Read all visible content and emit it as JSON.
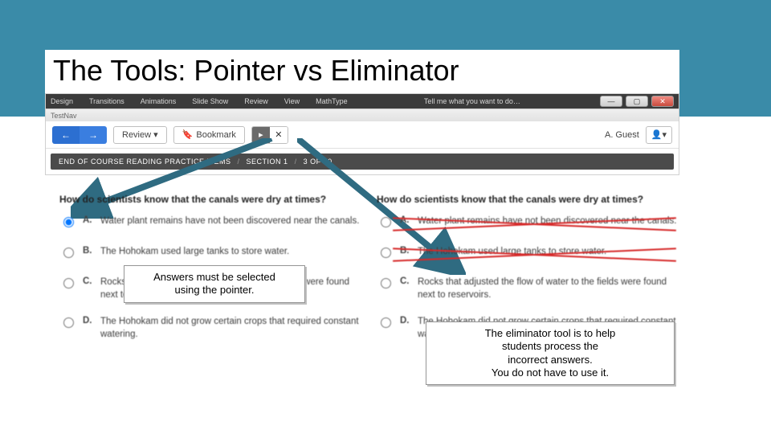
{
  "slide": {
    "title": "The Tools: Pointer vs Eliminator"
  },
  "winbar": {
    "tabs": [
      "Design",
      "Transitions",
      "Animations",
      "Slide Show",
      "Review",
      "View",
      "MathType"
    ],
    "hint": "Tell me what you want to do…"
  },
  "titlebar": {
    "app": "TestNav"
  },
  "toolbar": {
    "back_glyph": "←",
    "fwd_glyph": "→",
    "review_label": "Review ▾",
    "bookmark_label": "Bookmark",
    "pointer_glyph": "▸",
    "eliminator_glyph": "✕",
    "user_label": "A. Guest",
    "user_menu_icon": "👤▾"
  },
  "breadcrumb": {
    "a": "END OF COURSE READING PRACTICE ITEMS",
    "b": "SECTION 1",
    "c": "3 OF 30"
  },
  "question": {
    "prompt": "How do scientists know that the canals were dry at times?",
    "options": [
      {
        "label": "A.",
        "text": "Water plant remains have not been discovered near the canals."
      },
      {
        "label": "B.",
        "text": "The Hohokam used large tanks to store water."
      },
      {
        "label": "C.",
        "text": "Rocks that adjusted the flow of water to the fields were found next to reservoirs."
      },
      {
        "label": "D.",
        "text": "The Hohokam did not grow certain crops that required constant watering."
      }
    ]
  },
  "callouts": {
    "left_line1": "Answers must be selected",
    "left_line2": "using the pointer.",
    "right_line1": "The eliminator tool is to help",
    "right_line2": "students process the",
    "right_line3": "incorrect answers.",
    "right_line4": "You do not have to use it."
  }
}
